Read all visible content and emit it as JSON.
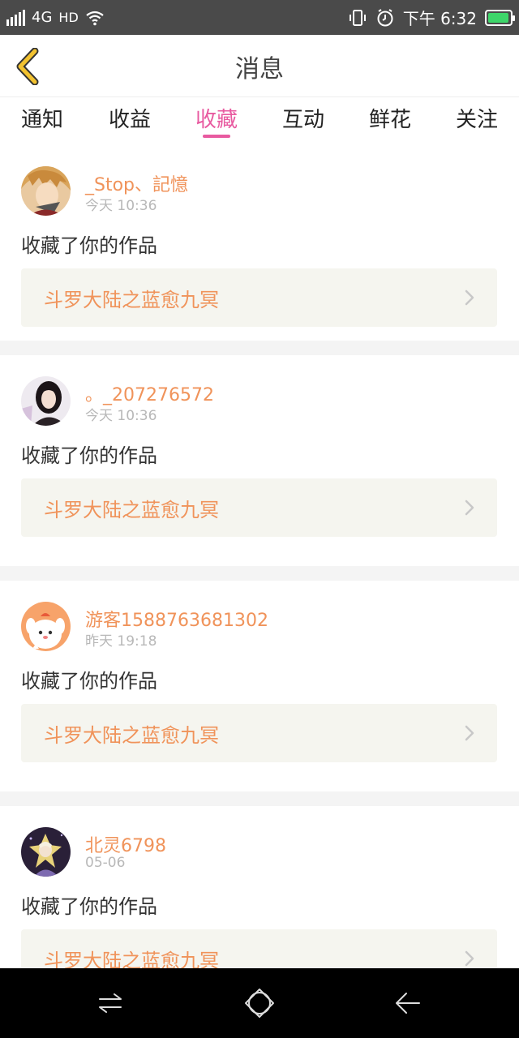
{
  "status_bar": {
    "network": "4G",
    "hd": "HD",
    "time": "下午 6:32",
    "battery_level": 0.95
  },
  "header": {
    "title": "消息"
  },
  "tabs": [
    {
      "label": "通知",
      "active": false
    },
    {
      "label": "收益",
      "active": false
    },
    {
      "label": "收藏",
      "active": true
    },
    {
      "label": "互动",
      "active": false
    },
    {
      "label": "鲜花",
      "active": false
    },
    {
      "label": "关注",
      "active": false
    }
  ],
  "items": [
    {
      "username": "_Stop、記憶",
      "time": "今天 10:36",
      "action": "收藏了你的作品",
      "work_title": "斗罗大陆之蓝愈九冥"
    },
    {
      "username": "。_207276572",
      "time": "今天 10:36",
      "action": "收藏了你的作品",
      "work_title": "斗罗大陆之蓝愈九冥"
    },
    {
      "username": "游客1588763681302",
      "time": "昨天 19:18",
      "action": "收藏了你的作品",
      "work_title": "斗罗大陆之蓝愈九冥"
    },
    {
      "username": "北灵6798",
      "time": "05-06",
      "action": "收藏了你的作品",
      "work_title": "斗罗大陆之蓝愈九冥"
    }
  ],
  "colors": {
    "accent": "#e85aa0",
    "username": "#f0935a",
    "back_arrow": "#f2c230",
    "work_box_bg": "#f5f5ef"
  }
}
